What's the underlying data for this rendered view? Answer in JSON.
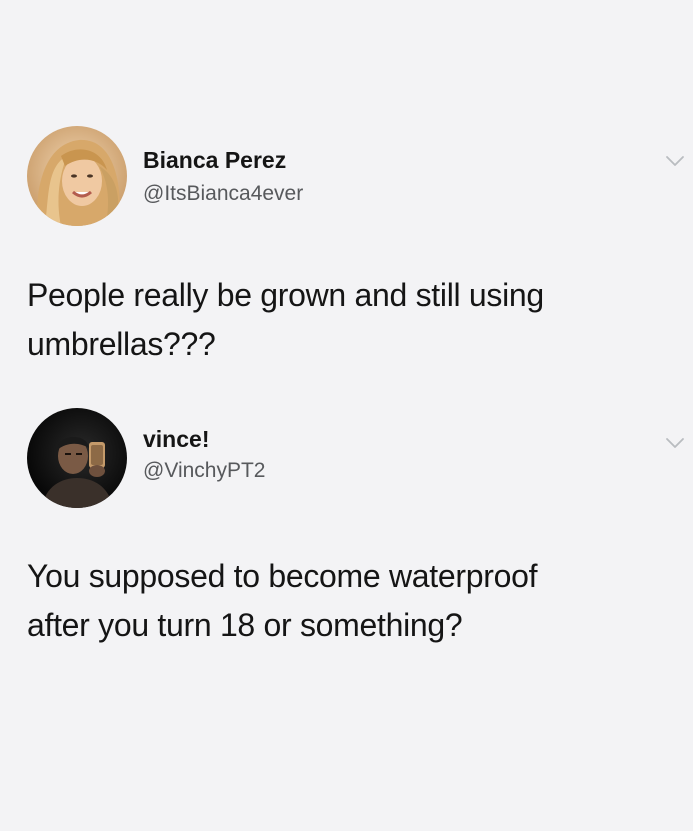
{
  "tweets": [
    {
      "display_name": "Bianca Perez",
      "handle": "@ItsBianca4ever",
      "text_lines": [
        "People really be grown and still using",
        "umbrellas???"
      ],
      "menu_icon": "chevron-down-icon"
    },
    {
      "display_name": "vince!",
      "handle": "@VinchyPT2",
      "text_lines": [
        "You supposed to become waterproof",
        "after you turn 18 or something?"
      ],
      "menu_icon": "chevron-down-icon"
    }
  ],
  "colors": {
    "background": "#f3f3f5",
    "text": "#151515",
    "handle": "#57595c",
    "chevron": "#b9bcc0"
  }
}
